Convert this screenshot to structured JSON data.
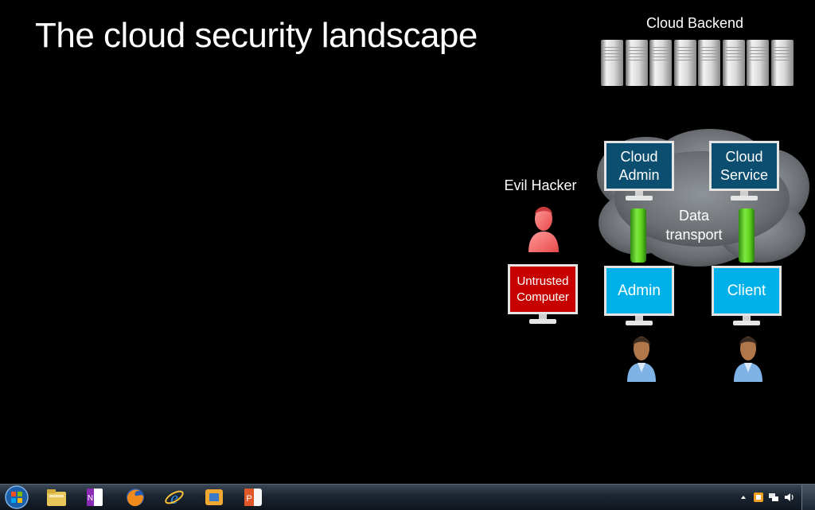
{
  "slide": {
    "title": "The cloud security landscape",
    "backend_label": "Cloud Backend",
    "hacker_label": "Evil Hacker",
    "transport_label_line1": "Data",
    "transport_label_line2": "transport",
    "monitors": {
      "cloud_admin": {
        "line1": "Cloud",
        "line2": "Admin",
        "color": "#0b4e6f"
      },
      "cloud_service": {
        "line1": "Cloud",
        "line2": "Service",
        "color": "#0b4e6f"
      },
      "untrusted": {
        "line1": "Untrusted",
        "line2": "Computer",
        "color": "#c70000"
      },
      "admin": {
        "label": "Admin",
        "color": "#00b0e8"
      },
      "client": {
        "label": "Client",
        "color": "#00b0e8"
      }
    }
  },
  "taskbar": {
    "icons": [
      "windows-start-icon",
      "file-explorer-icon",
      "onenote-icon",
      "firefox-icon",
      "internet-explorer-icon",
      "virtual-machine-icon",
      "powerpoint-icon"
    ],
    "tray": [
      "show-hidden-icons-chevron",
      "security-shield-icon",
      "network-icon",
      "volume-icon"
    ]
  }
}
